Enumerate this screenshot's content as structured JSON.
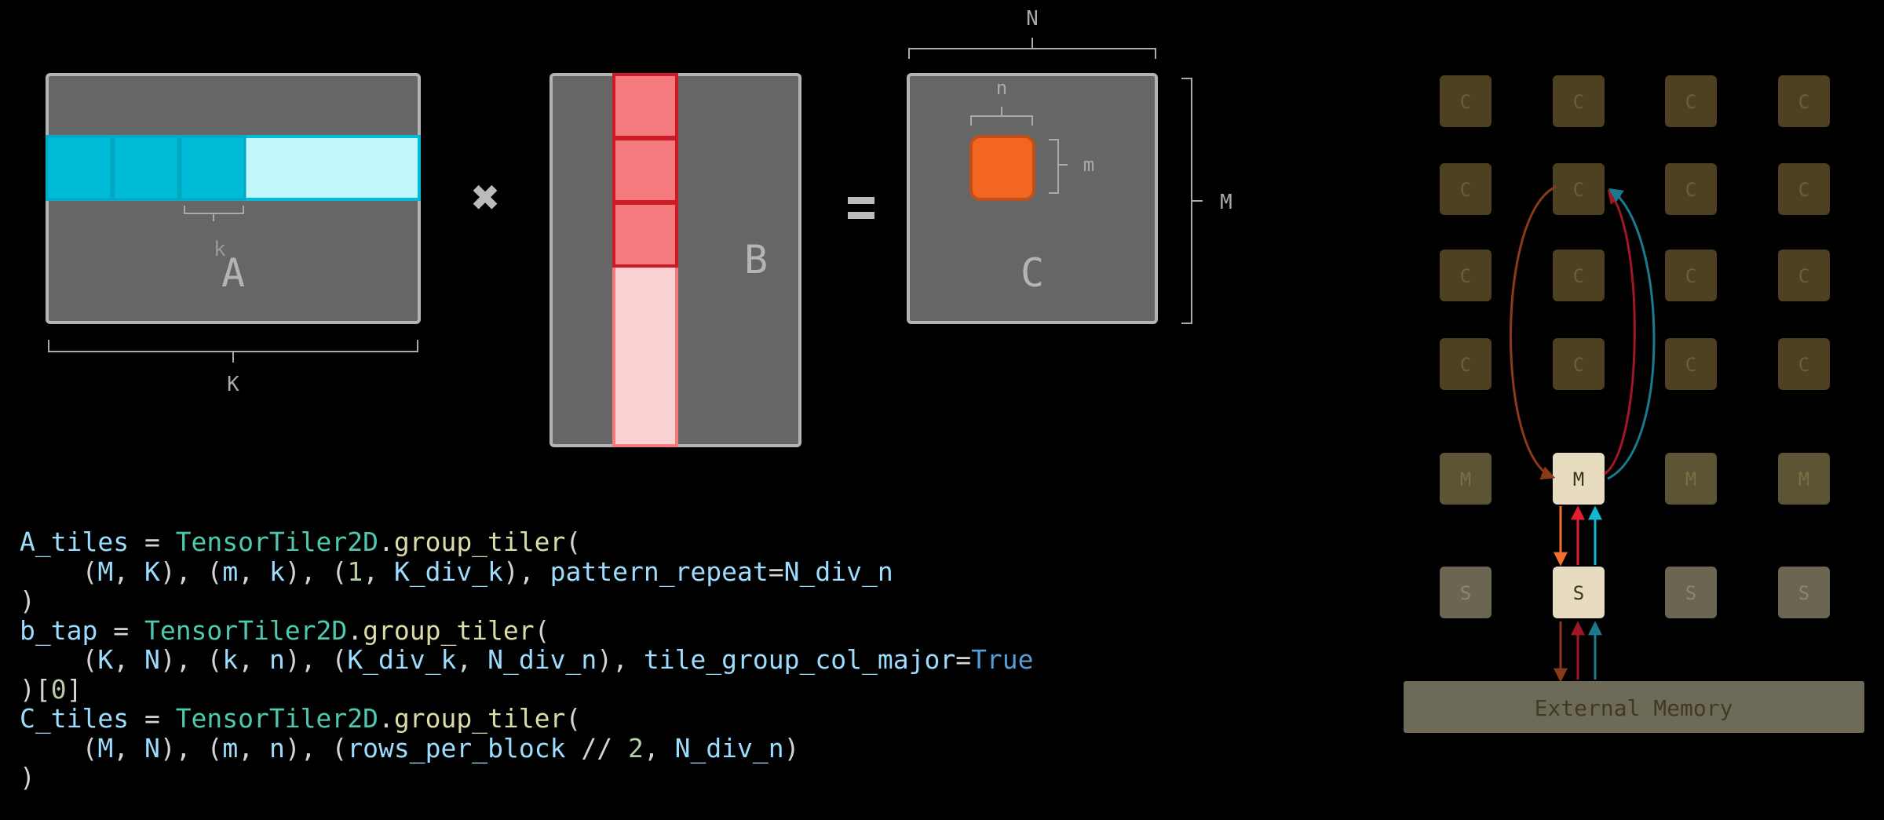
{
  "matrices": {
    "A": {
      "label": "A",
      "dim_label": "K",
      "tile_label": "k"
    },
    "B": {
      "label": "B"
    },
    "C": {
      "label": "C",
      "top_dim_label": "N",
      "side_dim_label": "M",
      "tile_col_label": "n",
      "tile_row_label": "m"
    },
    "operators": {
      "multiply": "✖",
      "equals": "="
    }
  },
  "array": {
    "compute_label": "C",
    "memory_label": "M",
    "shim_label": "S",
    "external_memory_label": "External Memory",
    "columns": 4,
    "compute_rows": 4,
    "active_column": 1
  },
  "colors": {
    "background": "#000000",
    "matrix_fill": "#666666",
    "matrix_border": "#b4b4b4",
    "a_tile": "#00bcd8",
    "a_row_light": "#c2f8fc",
    "b_tile": "#f47a7e",
    "b_col_light": "#fbd2d4",
    "b_border": "#cc1a26",
    "c_tile": "#f26622",
    "compute_tile": "#4e4122",
    "inactive_mem": "#5c5434",
    "active_tile": "#e8dcc0",
    "external_memory": "#6e6a58",
    "arrow_orange": "#f07030",
    "arrow_red": "#e02030",
    "arrow_cyan": "#10b8d0",
    "arrow_brown": "#8a3a1a",
    "arrow_darkred": "#a01828",
    "arrow_teal": "#1a7a90"
  },
  "code": {
    "lines": [
      [
        {
          "t": "A_tiles",
          "c": "var"
        },
        {
          "t": " = ",
          "c": "op"
        },
        {
          "t": "TensorTiler2D",
          "c": "cls"
        },
        {
          "t": ".",
          "c": "op"
        },
        {
          "t": "group_tiler",
          "c": "fn"
        },
        {
          "t": "(",
          "c": "op"
        }
      ],
      [
        {
          "t": "    (",
          "c": "op"
        },
        {
          "t": "M",
          "c": "var"
        },
        {
          "t": ", ",
          "c": "op"
        },
        {
          "t": "K",
          "c": "var"
        },
        {
          "t": "), (",
          "c": "op"
        },
        {
          "t": "m",
          "c": "var"
        },
        {
          "t": ", ",
          "c": "op"
        },
        {
          "t": "k",
          "c": "var"
        },
        {
          "t": "), (",
          "c": "op"
        },
        {
          "t": "1",
          "c": "num"
        },
        {
          "t": ", ",
          "c": "op"
        },
        {
          "t": "K_div_k",
          "c": "var"
        },
        {
          "t": "), ",
          "c": "op"
        },
        {
          "t": "pattern_repeat",
          "c": "var"
        },
        {
          "t": "=",
          "c": "op"
        },
        {
          "t": "N_div_n",
          "c": "var"
        }
      ],
      [
        {
          "t": ")",
          "c": "op"
        }
      ],
      [
        {
          "t": "b_tap",
          "c": "var"
        },
        {
          "t": " = ",
          "c": "op"
        },
        {
          "t": "TensorTiler2D",
          "c": "cls"
        },
        {
          "t": ".",
          "c": "op"
        },
        {
          "t": "group_tiler",
          "c": "fn"
        },
        {
          "t": "(",
          "c": "op"
        }
      ],
      [
        {
          "t": "    (",
          "c": "op"
        },
        {
          "t": "K",
          "c": "var"
        },
        {
          "t": ", ",
          "c": "op"
        },
        {
          "t": "N",
          "c": "var"
        },
        {
          "t": "), (",
          "c": "op"
        },
        {
          "t": "k",
          "c": "var"
        },
        {
          "t": ", ",
          "c": "op"
        },
        {
          "t": "n",
          "c": "var"
        },
        {
          "t": "), (",
          "c": "op"
        },
        {
          "t": "K_div_k",
          "c": "var"
        },
        {
          "t": ", ",
          "c": "op"
        },
        {
          "t": "N_div_n",
          "c": "var"
        },
        {
          "t": "), ",
          "c": "op"
        },
        {
          "t": "tile_group_col_major",
          "c": "var"
        },
        {
          "t": "=",
          "c": "op"
        },
        {
          "t": "True",
          "c": "kw"
        }
      ],
      [
        {
          "t": ")[",
          "c": "op"
        },
        {
          "t": "0",
          "c": "num"
        },
        {
          "t": "]",
          "c": "op"
        }
      ],
      [
        {
          "t": "C_tiles",
          "c": "var"
        },
        {
          "t": " = ",
          "c": "op"
        },
        {
          "t": "TensorTiler2D",
          "c": "cls"
        },
        {
          "t": ".",
          "c": "op"
        },
        {
          "t": "group_tiler",
          "c": "fn"
        },
        {
          "t": "(",
          "c": "op"
        }
      ],
      [
        {
          "t": "    (",
          "c": "op"
        },
        {
          "t": "M",
          "c": "var"
        },
        {
          "t": ", ",
          "c": "op"
        },
        {
          "t": "N",
          "c": "var"
        },
        {
          "t": "), (",
          "c": "op"
        },
        {
          "t": "m",
          "c": "var"
        },
        {
          "t": ", ",
          "c": "op"
        },
        {
          "t": "n",
          "c": "var"
        },
        {
          "t": "), (",
          "c": "op"
        },
        {
          "t": "rows_per_block",
          "c": "var"
        },
        {
          "t": " // ",
          "c": "op"
        },
        {
          "t": "2",
          "c": "num"
        },
        {
          "t": ", ",
          "c": "op"
        },
        {
          "t": "N_div_n",
          "c": "var"
        },
        {
          "t": ")",
          "c": "op"
        }
      ],
      [
        {
          "t": ")",
          "c": "op"
        }
      ]
    ]
  }
}
